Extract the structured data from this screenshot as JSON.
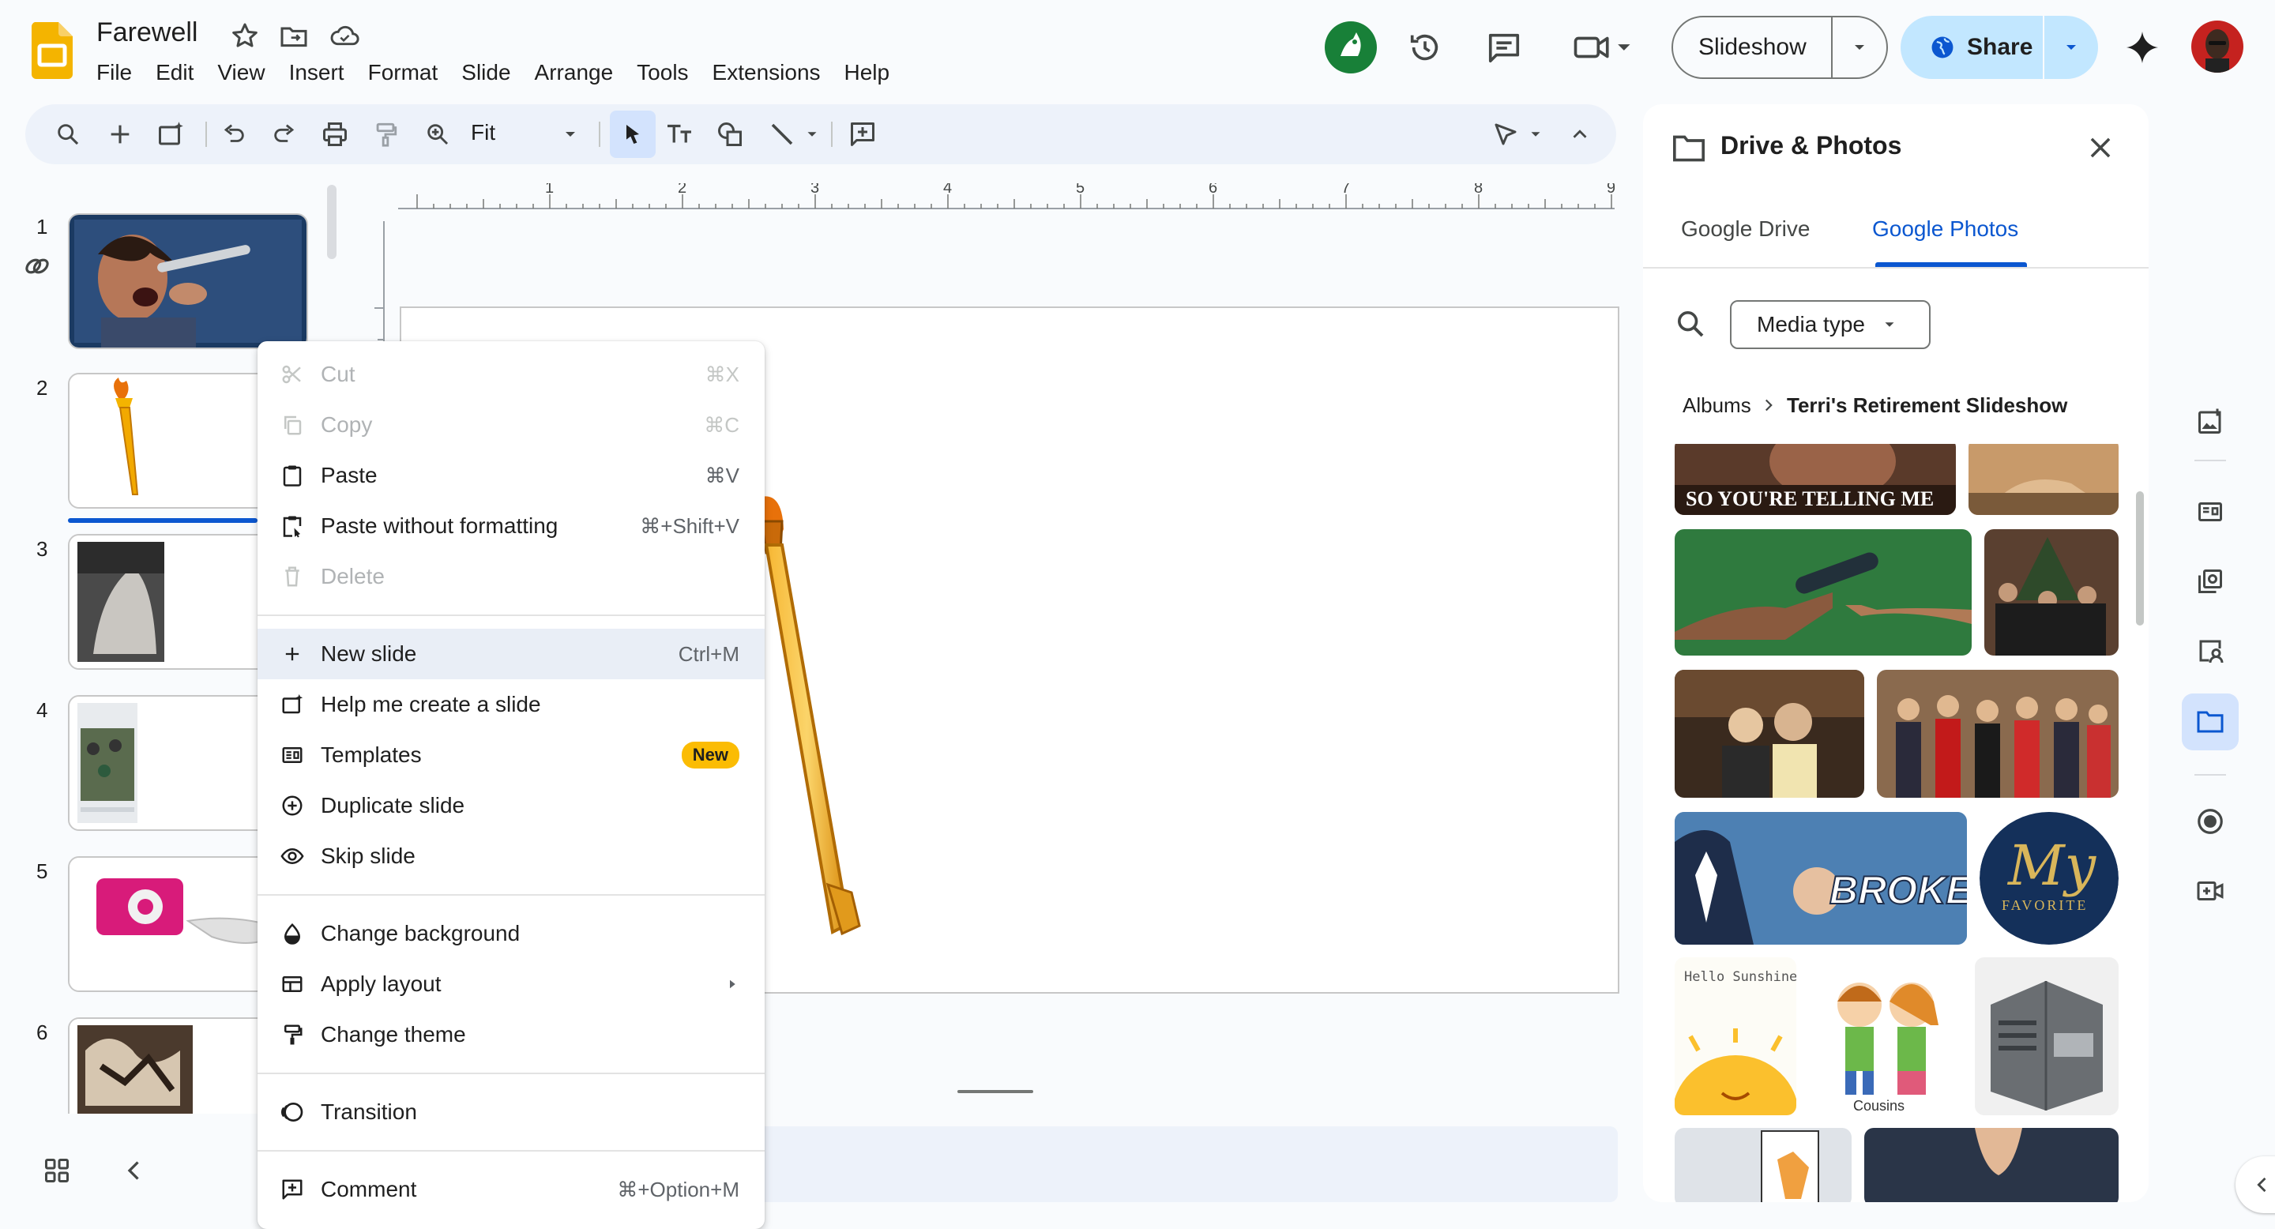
{
  "app": {
    "doc_title": "Farewell",
    "menus": [
      "File",
      "Edit",
      "View",
      "Insert",
      "Format",
      "Slide",
      "Arrange",
      "Tools",
      "Extensions",
      "Help"
    ],
    "slideshow_label": "Slideshow",
    "share_label": "Share"
  },
  "toolbar": {
    "zoom_label": "Fit"
  },
  "filmstrip": {
    "slide_numbers": [
      "1",
      "2",
      "3",
      "4",
      "5",
      "6"
    ],
    "selected_slide": 2
  },
  "context_menu": {
    "items": [
      {
        "label": "Cut",
        "shortcut": "⌘X",
        "icon": "scissors-icon",
        "disabled": true
      },
      {
        "label": "Copy",
        "shortcut": "⌘C",
        "icon": "copy-icon",
        "disabled": true
      },
      {
        "label": "Paste",
        "shortcut": "⌘V",
        "icon": "clipboard-icon",
        "disabled": false
      },
      {
        "label": "Paste without formatting",
        "shortcut": "⌘+Shift+V",
        "icon": "clipboard-plain-icon",
        "disabled": false
      },
      {
        "label": "Delete",
        "shortcut": "",
        "icon": "trash-icon",
        "disabled": true
      },
      {
        "label": "New slide",
        "shortcut": "Ctrl+M",
        "icon": "plus-icon",
        "disabled": false
      },
      {
        "label": "Help me create a slide",
        "shortcut": "",
        "icon": "ai-slide-icon",
        "disabled": false
      },
      {
        "label": "Templates",
        "badge": "New",
        "icon": "templates-icon",
        "disabled": false
      },
      {
        "label": "Duplicate slide",
        "shortcut": "",
        "icon": "duplicate-icon",
        "disabled": false
      },
      {
        "label": "Skip slide",
        "shortcut": "",
        "icon": "eye-icon",
        "disabled": false
      },
      {
        "label": "Change background",
        "shortcut": "",
        "icon": "drop-icon",
        "disabled": false
      },
      {
        "label": "Apply layout",
        "shortcut": "",
        "icon": "layout-icon",
        "disabled": false
      },
      {
        "label": "Change theme",
        "shortcut": "",
        "icon": "paint-roller-icon",
        "disabled": false
      },
      {
        "label": "Transition",
        "shortcut": "",
        "icon": "transition-icon",
        "disabled": false
      },
      {
        "label": "Comment",
        "shortcut": "⌘+Option+M",
        "icon": "comment-add-icon",
        "disabled": false
      }
    ]
  },
  "panel": {
    "title": "Drive & Photos",
    "tabs": [
      "Google Drive",
      "Google Photos"
    ],
    "active_tab": "Google Photos",
    "filter_label": "Media type",
    "breadcrumb_root": "Albums",
    "breadcrumb_current": "Terri's Retirement Slideshow",
    "photo_captions": {
      "telling_me": "SO YOU'RE TELLING ME",
      "broker": "BROKER",
      "my_favorite_script": "My",
      "my_favorite_text": "FAVORITE",
      "hello_sunshine": "Hello Sunshine!",
      "cousins": "Cousins"
    }
  },
  "colors": {
    "accent": "#0b57d0",
    "share_bg": "#c2e7ff",
    "slides_yellow": "#f4b400",
    "new_badge": "#fbbc04"
  }
}
